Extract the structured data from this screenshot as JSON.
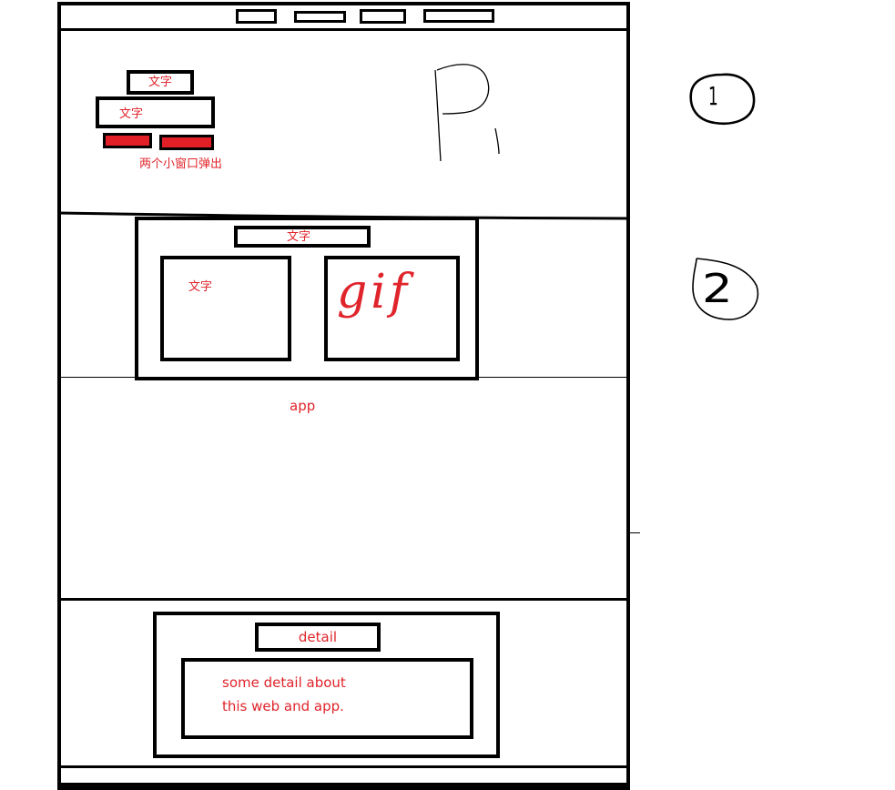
{
  "section1": {
    "label_small": "文字",
    "label_wide": "文字",
    "note": "两个小窗口弹出",
    "section_number": "1"
  },
  "section2": {
    "title_bar": "文字",
    "left_panel_text": "文字",
    "right_panel_text": "gif",
    "app_caption": "app",
    "section_number": "2"
  },
  "section3": {
    "title": "detail",
    "body_line1": "some detail about",
    "body_line2": "this web and app."
  },
  "colors": {
    "annotation_red": "#e0242b",
    "outline": "#000000",
    "background": "#ffffff"
  }
}
